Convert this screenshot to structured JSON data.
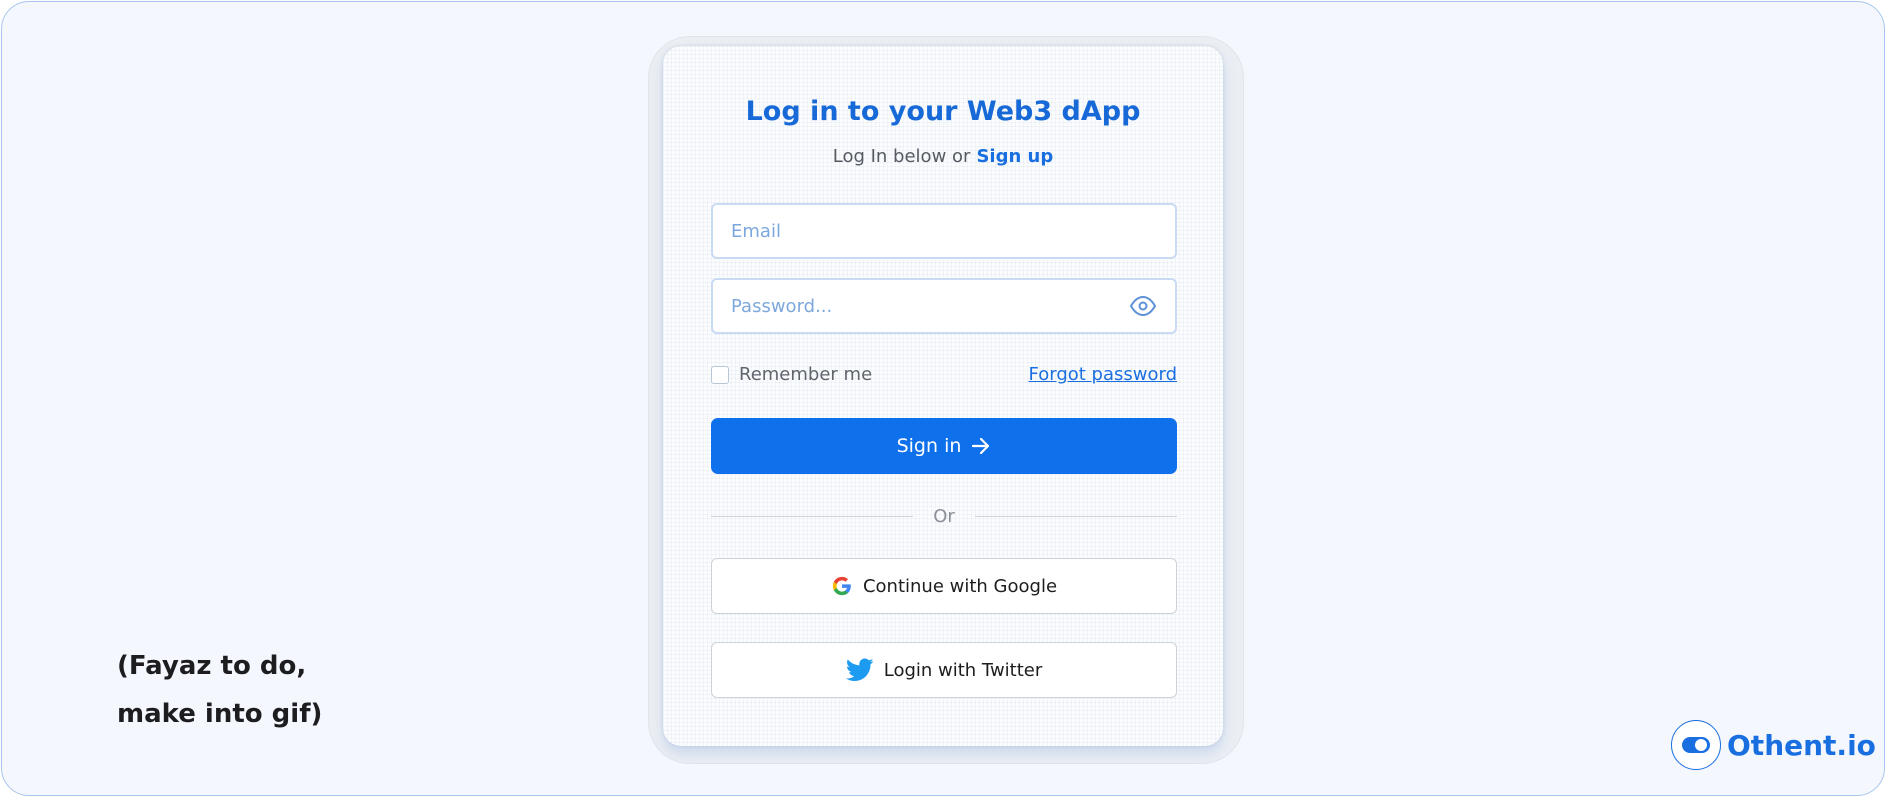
{
  "note": {
    "line1": "(Fayaz to do,",
    "line2": "make into gif)"
  },
  "login": {
    "title": "Log in to your Web3 dApp",
    "subtitle_prefix": "Log In below or",
    "signup_label": "Sign up",
    "email_placeholder": "Email",
    "password_placeholder": "Password...",
    "remember_label": "Remember me",
    "forgot_label": "Forgot password",
    "signin_label": "Sign in",
    "divider_label": "Or",
    "google_label": "Continue with Google",
    "twitter_label": "Login with Twitter"
  },
  "brand": {
    "name": "Othent.io"
  },
  "colors": {
    "accent": "#1a6fe0",
    "button": "#0f70ec",
    "background": "#f4f8fe"
  },
  "icons": [
    "eye-icon",
    "arrow-right-icon",
    "google-icon",
    "twitter-icon",
    "toggle-icon"
  ]
}
